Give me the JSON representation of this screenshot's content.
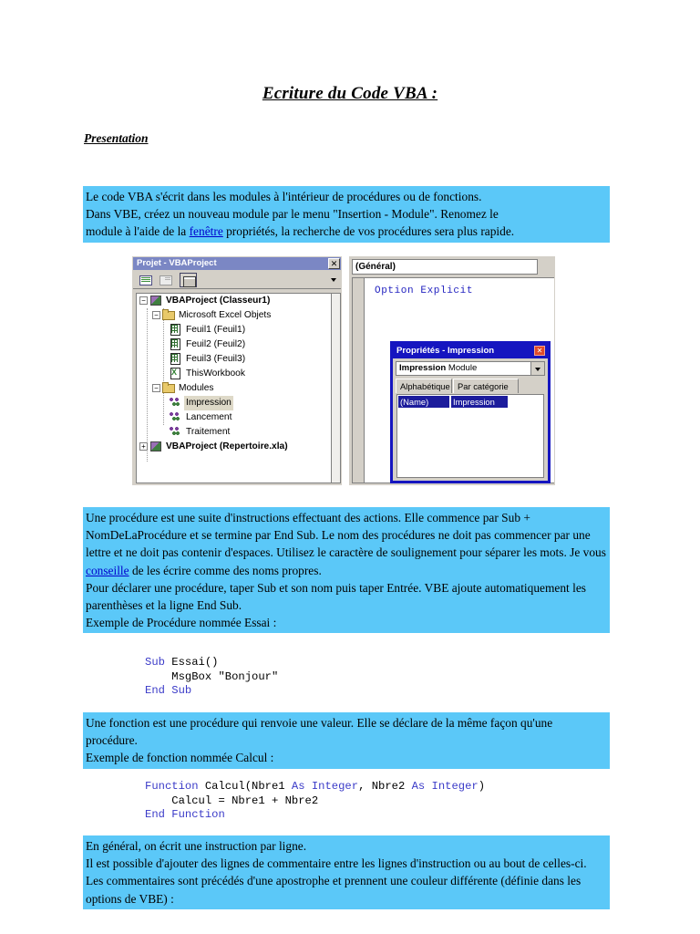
{
  "document": {
    "title": "Ecriture du Code VBA :",
    "subtitle": "Presentation"
  },
  "blocks": {
    "intro": {
      "line1": "Le code VBA s'écrit dans les modules à l'intérieur de procédures ou de fonctions.",
      "line2": "Dans VBE, créez un nouveau module par le menu \"Insertion - Module\". Renomez le",
      "line3_before": "module à l'aide de la ",
      "line3_link": "fenêtre",
      "line3_after": " propriétés, la recherche de vos procédures sera plus rapide."
    },
    "procedure": {
      "part1": "Une procédure est une suite d'instructions effectuant des actions. Elle commence par Sub + NomDeLaProcédure et se termine par End Sub. Le nom des procédures ne doit pas commencer par une lettre et ne doit pas contenir d'espaces. Utilisez le caractère de soulignement pour séparer les mots. Je vous ",
      "link": "conseille",
      "part2": " de les écrire comme des noms propres.",
      "line_declare": "Pour déclarer une procédure, taper Sub et son nom puis taper Entrée. VBE ajoute automatiquement les parenthèses et la ligne End Sub.",
      "line_example": "Exemple de Procédure nommée Essai :"
    },
    "fonction": {
      "line1": "Une fonction est une procédure qui renvoie une valeur. Elle se déclare de la même façon qu'une procédure.",
      "line2": "Exemple de fonction nommée Calcul :"
    },
    "commentaire": {
      "line1": "En général, on écrit une instruction par ligne.",
      "line2": "Il est possible d'ajouter des lignes de commentaire entre les lignes d'instruction ou au bout de celles-ci. Les commentaires sont précédés d'une apostrophe et prennent une couleur différente (définie dans les options de VBE) :"
    }
  },
  "code_essai": {
    "kw_sub": "Sub",
    "name": " Essai()",
    "body": "    MsgBox \"Bonjour\"",
    "kw_end": "End Sub"
  },
  "code_calcul": {
    "kw_function": "Function",
    "name": " Calcul(Nbre1 ",
    "kw_as1": "As Integer",
    "mid": ", Nbre2 ",
    "kw_as2": "As Integer",
    "close": ")",
    "body": "    Calcul = Nbre1 + Nbre2",
    "kw_end": "End Function"
  },
  "vbe": {
    "project_explorer": {
      "title": "Projet - VBAProject",
      "close_label": "✕",
      "toolbar": {
        "view_code": "View Code",
        "view_object": "View Object",
        "toggle_folders": "Toggle Folders"
      },
      "tree": [
        {
          "label": "VBAProject (Classeur1)",
          "indent": 1,
          "expander": "−",
          "icon": "project-icon",
          "bold": true,
          "selected": false
        },
        {
          "label": "Microsoft Excel Objets",
          "indent": 2,
          "expander": "−",
          "icon": "folder-icon",
          "bold": false,
          "selected": false
        },
        {
          "label": "Feuil1 (Feuil1)",
          "indent": 3,
          "expander": "",
          "icon": "worksheet-icon",
          "bold": false,
          "selected": false
        },
        {
          "label": "Feuil2 (Feuil2)",
          "indent": 3,
          "expander": "",
          "icon": "worksheet-icon",
          "bold": false,
          "selected": false
        },
        {
          "label": "Feuil3 (Feuil3)",
          "indent": 3,
          "expander": "",
          "icon": "worksheet-icon",
          "bold": false,
          "selected": false
        },
        {
          "label": "ThisWorkbook",
          "indent": 3,
          "expander": "",
          "icon": "workbook-icon",
          "bold": false,
          "selected": false
        },
        {
          "label": "Modules",
          "indent": 2,
          "expander": "−",
          "icon": "folder-icon",
          "bold": false,
          "selected": false
        },
        {
          "label": "Impression",
          "indent": 3,
          "expander": "",
          "icon": "module-icon",
          "bold": false,
          "selected": true
        },
        {
          "label": "Lancement",
          "indent": 3,
          "expander": "",
          "icon": "module-icon",
          "bold": false,
          "selected": false
        },
        {
          "label": "Traitement",
          "indent": 3,
          "expander": "",
          "icon": "module-icon",
          "bold": false,
          "selected": false
        },
        {
          "label": "VBAProject (Repertoire.xla)",
          "indent": 1,
          "expander": "+",
          "icon": "project-icon",
          "bold": true,
          "selected": false
        }
      ]
    },
    "code_pane": {
      "object_combo": "(Général)",
      "code": "Option Explicit"
    },
    "properties_window": {
      "title": "Propriétés - Impression",
      "close_label": "✕",
      "combo_name": "Impression",
      "combo_type": " Module",
      "tab_alpha": "Alphabétique",
      "tab_category": "Par catégorie",
      "rows": [
        {
          "key": "(Name)",
          "value": "Impression"
        }
      ]
    }
  },
  "colors": {
    "highlight_bg": "#5bc8f8",
    "link": "#0000cc",
    "vba_keyword": "#3b3bc8",
    "vbe_title_bar": "#7b87c4",
    "properties_title_bar": "#1515c0",
    "tree_selection": "#ded9c8",
    "grid_selection": "#1c1c9c"
  }
}
